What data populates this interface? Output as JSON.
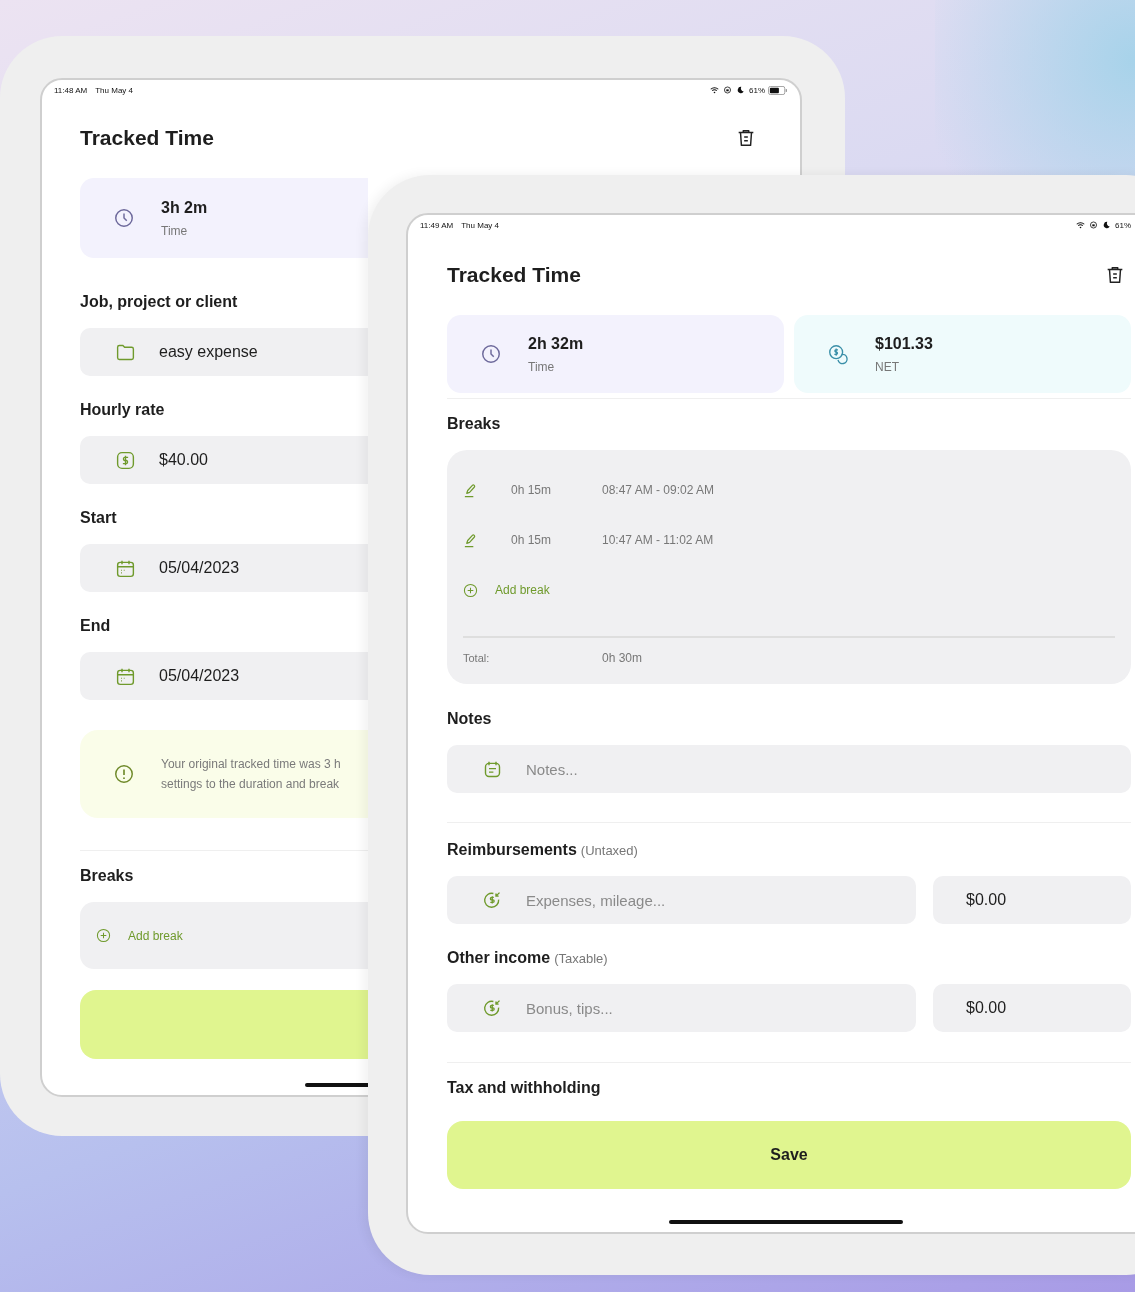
{
  "back_tablet": {
    "status_bar": {
      "time": "11:48 AM",
      "date": "Thu May 4",
      "battery": "61%"
    },
    "title": "Tracked Time",
    "summary": {
      "value": "3h 2m",
      "label": "Time"
    },
    "fields": [
      {
        "kind": "project",
        "label": "Job, project or client",
        "value": "easy expense"
      },
      {
        "kind": "rate",
        "label": "Hourly rate",
        "value": "$40.00"
      },
      {
        "kind": "date",
        "label": "Start",
        "value": "05/04/2023"
      },
      {
        "kind": "date",
        "label": "End",
        "value": "05/04/2023"
      }
    ],
    "notice": [
      "Your original tracked time was 3 h",
      "settings to the duration and break"
    ],
    "breaks_label": "Breaks",
    "add_break": "Add break"
  },
  "front_tablet": {
    "status_bar": {
      "time": "11:49 AM",
      "date": "Thu May 4",
      "battery": "61%"
    },
    "title": "Tracked Time",
    "summary_cards": [
      {
        "kind": "time",
        "value": "2h 32m",
        "label": "Time"
      },
      {
        "kind": "net",
        "value": "$101.33",
        "label": "NET"
      }
    ],
    "breaks": {
      "label": "Breaks",
      "items": [
        {
          "duration": "0h 15m",
          "range": "08:47 AM - 09:02 AM"
        },
        {
          "duration": "0h 15m",
          "range": "10:47 AM - 11:02 AM"
        }
      ],
      "add_label": "Add break",
      "total_label": "Total:",
      "total_value": "0h 30m"
    },
    "notes": {
      "label": "Notes",
      "placeholder": "Notes..."
    },
    "income_sections": [
      {
        "label": "Reimbursements",
        "note": "(Untaxed)",
        "placeholder": "Expenses, mileage...",
        "amount": "$0.00"
      },
      {
        "label": "Other income",
        "note": "(Taxable)",
        "placeholder": "Bonus, tips...",
        "amount": "$0.00"
      }
    ],
    "tax_label": "Tax and withholding",
    "save_label": "Save"
  }
}
